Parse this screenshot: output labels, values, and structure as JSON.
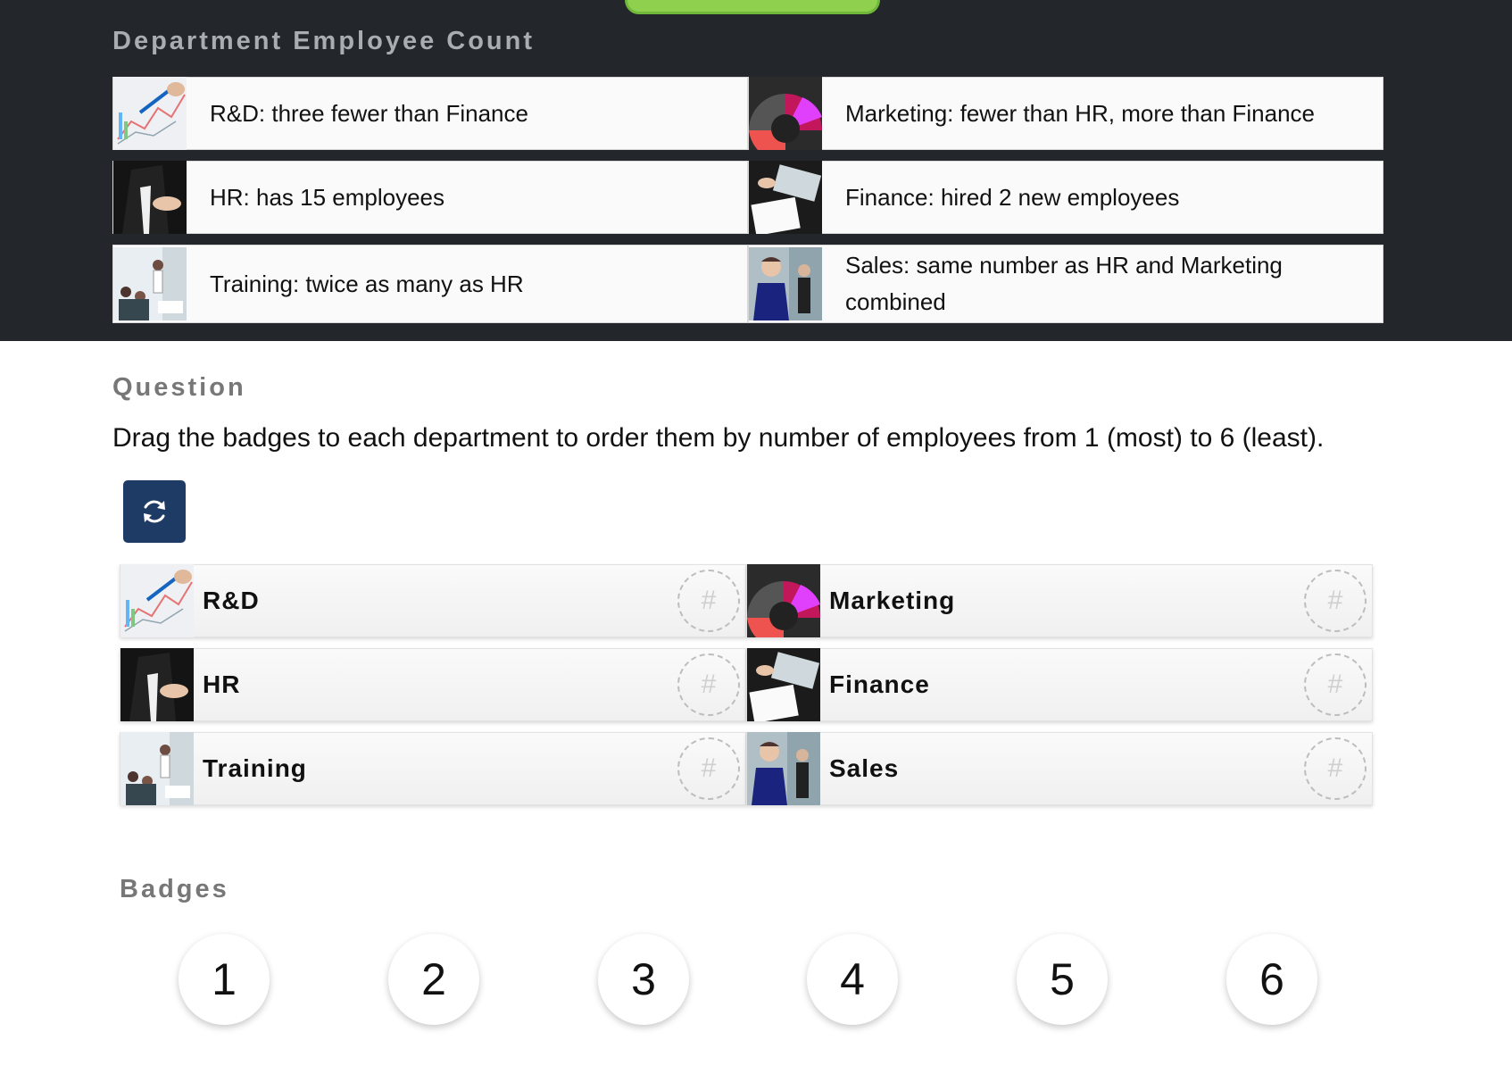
{
  "colors": {
    "panel_bg": "#23272b",
    "reset_button_bg": "#1e3b66",
    "accent_green": "#8fd14f"
  },
  "clues_section": {
    "title": "Department Employee Count",
    "clues": [
      {
        "text": "R&D: three fewer than Finance",
        "icon": "rd-photo"
      },
      {
        "text": "Marketing: fewer than HR, more than Finance",
        "icon": "marketing-photo"
      },
      {
        "text": "HR: has 15 employees",
        "icon": "hr-photo"
      },
      {
        "text": "Finance: hired 2 new employees",
        "icon": "finance-photo"
      },
      {
        "text": "Training: twice as many as HR",
        "icon": "training-photo"
      },
      {
        "text": "Sales: same number as HR and Marketing combined",
        "icon": "sales-photo"
      }
    ]
  },
  "question": {
    "title": "Question",
    "text": "Drag the badges to each department to order them by number of employees from 1 (most) to 6 (least).",
    "reset_icon": "refresh-icon"
  },
  "departments": [
    {
      "label": "R&D",
      "slot": "#"
    },
    {
      "label": "Marketing",
      "slot": "#"
    },
    {
      "label": "HR",
      "slot": "#"
    },
    {
      "label": "Finance",
      "slot": "#"
    },
    {
      "label": "Training",
      "slot": "#"
    },
    {
      "label": "Sales",
      "slot": "#"
    }
  ],
  "badges_section": {
    "title": "Badges",
    "badges": [
      "1",
      "2",
      "3",
      "4",
      "5",
      "6"
    ]
  }
}
